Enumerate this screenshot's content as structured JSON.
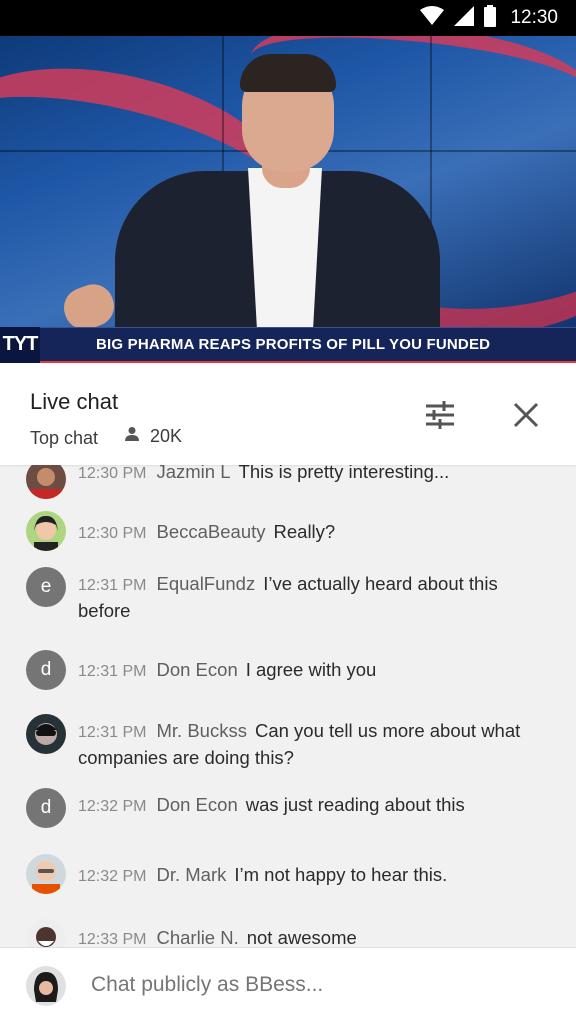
{
  "status_bar": {
    "time": "12:30"
  },
  "video": {
    "channel_logo": "TYT",
    "headline": "BIG PHARMA REAPS PROFITS OF PILL YOU FUNDED"
  },
  "chat_header": {
    "title": "Live chat",
    "mode": "Top chat",
    "viewer_count": "20K",
    "filter_icon": "sliders-icon",
    "close_icon": "close-icon"
  },
  "messages": [
    {
      "time": "12:30 PM",
      "author": "Jazmin L",
      "text": "This is pretty interesting...",
      "avatar": "photo"
    },
    {
      "time": "12:30 PM",
      "author": "BeccaBeauty",
      "text": "Really?",
      "avatar": "photo"
    },
    {
      "time": "12:31 PM",
      "author": "EqualFundz",
      "text": "I’ve actually heard about this before",
      "avatar": "e"
    },
    {
      "time": "12:31 PM",
      "author": "Don Econ",
      "text": "I agree with you",
      "avatar": "d"
    },
    {
      "time": "12:31 PM",
      "author": "Mr. Buckss",
      "text": "Can you tell us more about what companies are doing this?",
      "avatar": "photo"
    },
    {
      "time": "12:32 PM",
      "author": "Don Econ",
      "text": "was just reading about this",
      "avatar": "d"
    },
    {
      "time": "12:32 PM",
      "author": "Dr. Mark",
      "text": "I’m not happy to hear this.",
      "avatar": "photo"
    },
    {
      "time": "12:33 PM",
      "author": "Charlie N.",
      "text": "not awesome",
      "avatar": "photo"
    }
  ],
  "input": {
    "placeholder": "Chat publicly as BBess..."
  },
  "colors": {
    "accent_red": "#e53935",
    "headline_bar": "#15255a",
    "letter_avatar": "#757575"
  }
}
